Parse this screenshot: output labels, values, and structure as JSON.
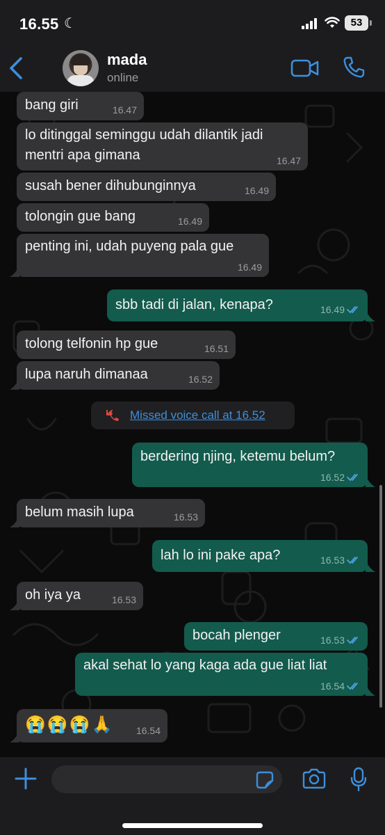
{
  "status_bar": {
    "time": "16.55",
    "battery": "53"
  },
  "header": {
    "contact_name": "mada",
    "contact_status": "online"
  },
  "messages": [
    {
      "dir": "in",
      "text": "bang giri",
      "time": "16.47"
    },
    {
      "dir": "in",
      "text": "lo ditinggal seminggu udah dilantik jadi\nmentri apa gimana",
      "time": "16.47"
    },
    {
      "dir": "in",
      "text": "susah bener dihubunginnya",
      "time": "16.49"
    },
    {
      "dir": "in",
      "text": "tolongin gue bang",
      "time": "16.49"
    },
    {
      "dir": "in",
      "text": "penting ini, udah puyeng pala gue",
      "time": "16.49"
    },
    {
      "dir": "out",
      "text": "sbb tadi di jalan, kenapa?",
      "time": "16.49"
    },
    {
      "dir": "in",
      "text": "tolong telfonin hp gue",
      "time": "16.51"
    },
    {
      "dir": "in",
      "text": "lupa naruh dimanaa",
      "time": "16.52"
    },
    {
      "dir": "out",
      "text": "berdering njing, ketemu belum?",
      "time": "16.52"
    },
    {
      "dir": "in",
      "text": "belum masih lupa",
      "time": "16.53"
    },
    {
      "dir": "out",
      "text": "lah lo ini pake apa?",
      "time": "16.53"
    },
    {
      "dir": "in",
      "text": "oh iya ya",
      "time": "16.53"
    },
    {
      "dir": "out",
      "text": "bocah plenger",
      "time": "16.53"
    },
    {
      "dir": "out",
      "text": "akal sehat lo yang kaga ada gue liat liat",
      "time": "16.54"
    },
    {
      "dir": "in",
      "text": "😭😭😭🙏",
      "time": "16.54"
    }
  ],
  "missed_call": {
    "label": "Missed voice call at 16.52"
  },
  "input": {
    "placeholder": ""
  },
  "colors": {
    "accent": "#3d8fdc",
    "incoming_bubble": "#343436",
    "outgoing_bubble": "#135b4d",
    "read_tick": "#4fa3e0",
    "missed_call_icon": "#e5463a"
  }
}
